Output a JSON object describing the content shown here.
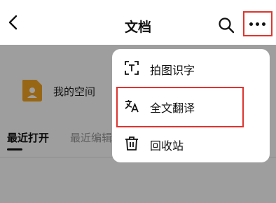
{
  "header": {
    "title": "文档",
    "back_icon": "chevron-left-icon",
    "search_icon": "search-icon",
    "more_icon": "more-horizontal-icon"
  },
  "space_card": {
    "label": "我的空间",
    "icon": "user-folder-icon",
    "icon_color": "#f5a623"
  },
  "tabs": [
    {
      "label": "最近打开",
      "active": true
    },
    {
      "label": "最近编辑",
      "active": false
    }
  ],
  "menu": {
    "items": [
      {
        "label": "拍图识字",
        "icon": "scan-text-icon"
      },
      {
        "label": "全文翻译",
        "icon": "translate-icon",
        "highlighted": true
      },
      {
        "label": "回收站",
        "icon": "trash-icon"
      }
    ]
  },
  "colors": {
    "highlight": "#e0342e",
    "overlay": "rgba(0,0,0,0.38)"
  }
}
